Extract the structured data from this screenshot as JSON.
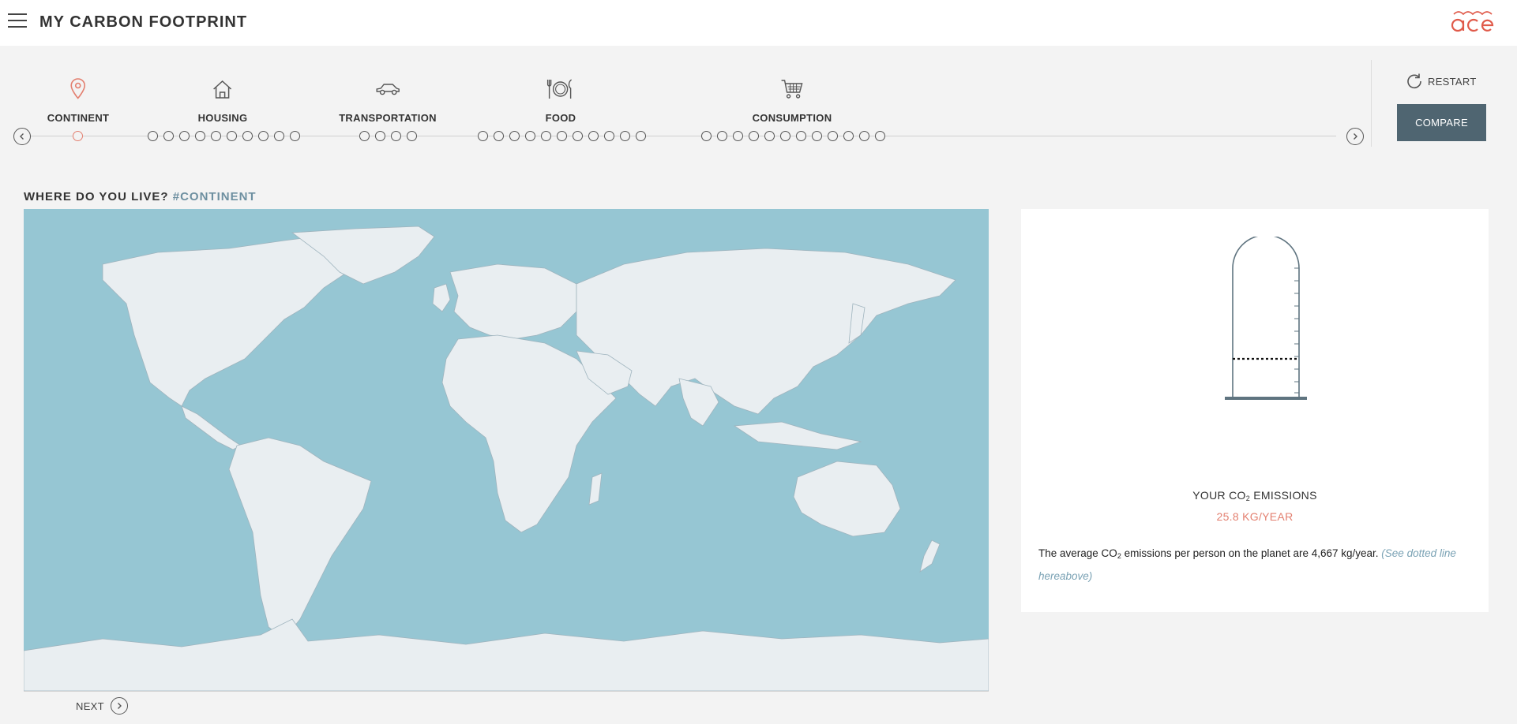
{
  "header": {
    "title": "MY CARBON FOOTPRINT",
    "logo_text": "ace",
    "logo_color": "#e05a4a"
  },
  "steps": [
    {
      "label": "CONTINENT",
      "icon": "location-pin-icon",
      "active": true,
      "dots": 1
    },
    {
      "label": "HOUSING",
      "icon": "house-icon",
      "active": false,
      "dots": 10
    },
    {
      "label": "TRANSPORTATION",
      "icon": "car-icon",
      "active": false,
      "dots": 4
    },
    {
      "label": "FOOD",
      "icon": "plate-cutlery-icon",
      "active": false,
      "dots": 11
    },
    {
      "label": "CONSUMPTION",
      "icon": "shopping-cart-icon",
      "active": false,
      "dots": 12
    }
  ],
  "toolbar": {
    "restart_label": "RESTART",
    "compare_label": "COMPARE"
  },
  "question": {
    "text": "WHERE DO YOU LIVE?",
    "hashtag": "#CONTINENT"
  },
  "emissions": {
    "title_prefix": "YOUR CO",
    "title_sub": "2",
    "title_suffix": " EMISSIONS",
    "value": "25.8 KG/YEAR",
    "average_prefix": "The average CO",
    "average_sub": "2",
    "average_suffix": " emissions per person on the planet are 4,667 kg/year.",
    "average_note": "(See dotted line hereabove)"
  },
  "navigation": {
    "next_label": "NEXT"
  },
  "colors": {
    "accent": "#e37f6f",
    "button": "#4f6571",
    "ocean": "#96c6d3",
    "land": "#e9eef1",
    "hashtag": "#6d8fa0"
  }
}
